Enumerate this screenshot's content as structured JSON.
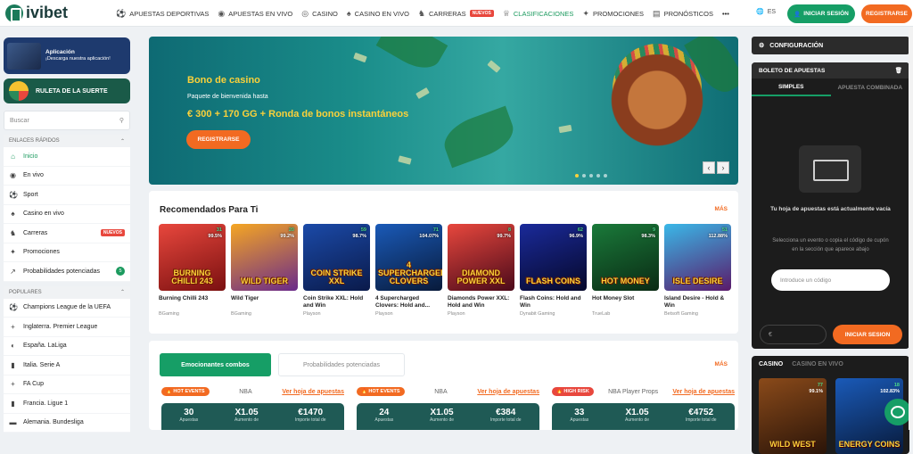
{
  "brand": {
    "name": "ivibet",
    "accent": "#169e66",
    "orange": "#f26a21"
  },
  "nav": [
    {
      "label": "APUESTAS DEPORTIVAS",
      "icon": "soccer-ball-icon"
    },
    {
      "label": "APUESTAS EN VIVO",
      "icon": "live-icon"
    },
    {
      "label": "CASINO",
      "icon": "casino-chip-icon"
    },
    {
      "label": "CASINO EN VIVO",
      "icon": "live-casino-icon"
    },
    {
      "label": "CARRERAS",
      "icon": "horse-icon",
      "badge": "NUEVOS"
    },
    {
      "label": "CLASIFICACIONES",
      "icon": "trophy-icon"
    },
    {
      "label": "PROMOCIONES",
      "icon": "gift-icon"
    },
    {
      "label": "PRONÓSTICOS",
      "icon": "forecast-icon"
    }
  ],
  "lang": "ES",
  "login_label": "INICIAR SESIÓN",
  "register_label": "REGISTRARSE",
  "sidebar": {
    "app_title": "Aplicación",
    "app_sub": "¡Descarga nuestra aplicación!",
    "wheel_label": "RULETA DE LA SUERTE",
    "search_placeholder": "Buscar",
    "quick_title": "ENLACES RÁPIDOS",
    "quick": [
      {
        "label": "Inicio",
        "icon": "home-icon"
      },
      {
        "label": "En vivo",
        "icon": "live-icon"
      },
      {
        "label": "Sport",
        "icon": "soccer-ball-icon"
      },
      {
        "label": "Casino en vivo",
        "icon": "live-casino-icon"
      },
      {
        "label": "Carreras",
        "icon": "horse-icon",
        "badge": "NUEVOS"
      },
      {
        "label": "Promociones",
        "icon": "gift-icon"
      },
      {
        "label": "Probabilidades potenciadas",
        "icon": "boost-icon",
        "count": "5"
      }
    ],
    "popular_title": "POPULARES",
    "popular": [
      {
        "label": "Champions League de la UEFA",
        "icon": "soccer-ball-icon"
      },
      {
        "label": "Inglaterra. Premier League",
        "icon": "england-flag-icon"
      },
      {
        "label": "España. LaLiga",
        "icon": "laliga-icon"
      },
      {
        "label": "Italia. Serie A",
        "icon": "italy-flag-icon"
      },
      {
        "label": "FA Cup",
        "icon": "england-flag-icon"
      },
      {
        "label": "Francia. Ligue 1",
        "icon": "france-flag-icon"
      },
      {
        "label": "Alemania. Bundesliga",
        "icon": "germany-flag-icon"
      }
    ]
  },
  "hero": {
    "title": "Bono de casino",
    "sub": "Paquete de bienvenida hasta",
    "prize": "€ 300 + 170 GG + Ronda de bonos instantáneos",
    "button": "REGISTRARSE"
  },
  "recommended": {
    "title": "Recomendados Para Ti",
    "more": "MÁS",
    "games": [
      {
        "name": "Burning Chilli 243",
        "provider": "BGaming",
        "players": "31",
        "rtp": "99.5%",
        "art": "BURNING CHILLI 243",
        "colors": [
          "#e8473d",
          "#7a1010"
        ]
      },
      {
        "name": "Wild Tiger",
        "provider": "BGaming",
        "players": "20",
        "rtp": "99.2%",
        "art": "WILD TIGER",
        "colors": [
          "#f5a623",
          "#6a2a8a"
        ]
      },
      {
        "name": "Coin Strike XXL: Hold and Win",
        "provider": "Playson",
        "players": "59",
        "rtp": "98.7%",
        "art": "COIN STRIKE XXL",
        "colors": [
          "#1b4aa8",
          "#0a1a4a"
        ]
      },
      {
        "name": "4 Supercharged Clovers: Hold and...",
        "provider": "Playson",
        "players": "71",
        "rtp": "104.07%",
        "art": "4 SUPERCHARGED CLOVERS",
        "colors": [
          "#1a5ab8",
          "#081a3a"
        ]
      },
      {
        "name": "Diamonds Power XXL: Hold and Win",
        "provider": "Playson",
        "players": "8",
        "rtp": "99.7%",
        "art": "DIAMOND POWER XXL",
        "colors": [
          "#e8473d",
          "#4a0a1a"
        ]
      },
      {
        "name": "Flash Coins: Hold and Win",
        "provider": "Dynabit Gaming",
        "players": "62",
        "rtp": "96.9%",
        "art": "FLASH COINS",
        "colors": [
          "#1a2a9a",
          "#06082a"
        ]
      },
      {
        "name": "Hot Money Slot",
        "provider": "TrueLab",
        "players": "9",
        "rtp": "98.3%",
        "art": "HOT MONEY",
        "colors": [
          "#1a7a3a",
          "#0a2a14"
        ]
      },
      {
        "name": "Island Desire - Hold & Win",
        "provider": "Betsoft Gaming",
        "players": "51",
        "rtp": "112.88%",
        "art": "ISLE DESIRE",
        "colors": [
          "#3ab8e8",
          "#5a1a6a"
        ]
      }
    ]
  },
  "combos": {
    "tab_active": "Emocionantes combos",
    "tab_other": "Probabilidades potenciadas",
    "more": "MÁS",
    "link": "Ver hoja de apuestas",
    "cards": [
      {
        "tag": "HOT EVENTS",
        "league": "NBA",
        "bets": "30",
        "bets_label": "Apuestas",
        "boost": "X1.05",
        "boost_label": "Aumento de",
        "total": "€1470",
        "total_label": "Importe total de"
      },
      {
        "tag": "HOT EVENTS",
        "league": "NBA",
        "bets": "24",
        "bets_label": "Apuestas",
        "boost": "X1.05",
        "boost_label": "Aumento de",
        "total": "€384",
        "total_label": "Importe total de"
      },
      {
        "tag": "HIGH RISK",
        "league": "NBA Player Props",
        "bets": "33",
        "bets_label": "Apuestas",
        "boost": "X1.05",
        "boost_label": "Aumento de",
        "total": "€4752",
        "total_label": "Importe total de"
      }
    ]
  },
  "right": {
    "config": "CONFIGURACIÓN",
    "betslip_title": "BOLETO DE APUESTAS",
    "tab_simple": "SIMPLES",
    "tab_combo": "APUESTA COMBINADA",
    "empty_title": "Tu hoja de apuestas está actualmente vacía",
    "empty_sub": "Selecciona un evento o copia el código de cupón en la sección que aparece abajo",
    "code_placeholder": "Introduce un código",
    "currency": "€",
    "start_button": "INICIAR SESION",
    "casino_tab": "CASINO",
    "casino_live_tab": "CASINO EN VIVO",
    "casino_games": [
      {
        "players": "77",
        "rtp": "99.1%",
        "art": "WILD WEST",
        "colors": [
          "#8a4a1a",
          "#2a1408"
        ]
      },
      {
        "players": "18",
        "rtp": "102.83%",
        "art": "ENERGY COINS",
        "colors": [
          "#1a5ab8",
          "#081a3a"
        ]
      }
    ]
  }
}
